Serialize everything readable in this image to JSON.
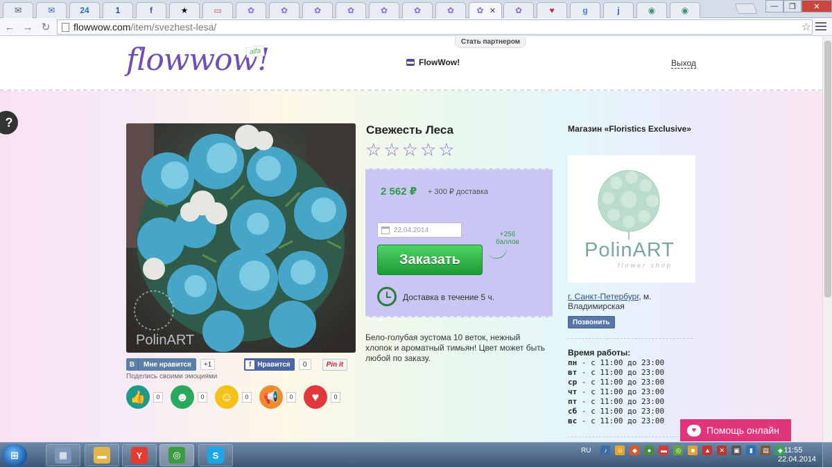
{
  "browser": {
    "tabs": [
      {
        "icon": "mail-icon",
        "label": "",
        "glyph": "✉",
        "color": "#445566"
      },
      {
        "icon": "mail-ru-icon",
        "label": "",
        "glyph": "✉",
        "color": "#2a68b8"
      },
      {
        "icon": "site-24-icon",
        "label": "24",
        "glyph": "24",
        "color": "#2d6db5"
      },
      {
        "icon": "site-1-icon",
        "label": "1",
        "glyph": "1",
        "color": "#1c4f8f"
      },
      {
        "icon": "facebook-icon",
        "label": "",
        "glyph": "f",
        "color": "#3b5998"
      },
      {
        "icon": "black-star-icon",
        "label": "",
        "glyph": "★",
        "color": "#111111"
      },
      {
        "icon": "gallery-icon",
        "label": "",
        "glyph": "▭",
        "color": "#c2473b"
      },
      {
        "icon": "flowwow-icon",
        "label": "",
        "glyph": "✿",
        "color": "#8b6ad1"
      },
      {
        "icon": "flowwow-icon",
        "label": "",
        "glyph": "✿",
        "color": "#8b6ad1"
      },
      {
        "icon": "flowwow-icon",
        "label": "",
        "glyph": "✿",
        "color": "#8b6ad1"
      },
      {
        "icon": "flowwow-icon",
        "label": "",
        "glyph": "✿",
        "color": "#8b6ad1"
      },
      {
        "icon": "flowwow-icon",
        "label": "",
        "glyph": "✿",
        "color": "#8b6ad1"
      },
      {
        "icon": "flowwow-icon",
        "label": "",
        "glyph": "✿",
        "color": "#8b6ad1"
      },
      {
        "icon": "flowwow-icon",
        "label": "",
        "glyph": "✿",
        "color": "#8b6ad1"
      },
      {
        "icon": "flowwow-icon",
        "label": "",
        "glyph": "✿",
        "color": "#8b6ad1",
        "active": true
      },
      {
        "icon": "flowwow-icon",
        "label": "",
        "glyph": "✿",
        "color": "#8b6ad1"
      },
      {
        "icon": "chat-icon",
        "label": "",
        "glyph": "♥",
        "color": "#cc2244"
      },
      {
        "icon": "google-icon",
        "label": "",
        "glyph": "g",
        "color": "#3f7de4"
      },
      {
        "icon": "site-j-icon",
        "label": "",
        "glyph": "j",
        "color": "#2a5fa4"
      },
      {
        "icon": "eye-icon",
        "label": "",
        "glyph": "◉",
        "color": "#3b8f72"
      },
      {
        "icon": "eye-icon",
        "label": "",
        "glyph": "◉",
        "color": "#3b8f72"
      }
    ],
    "url_host": "flowwow.com",
    "url_path": "/item/svezhest-lesa/"
  },
  "header": {
    "logo": "flowwow!",
    "logo_badge": "alfa",
    "partner": "Стать партнером",
    "brand_link": "FlowWow!",
    "logout": "Выход"
  },
  "help_button": "?",
  "product": {
    "title": "Свежесть Леса",
    "rating": 0,
    "rating_max": 5,
    "photo_watermark": "PolinART",
    "price": "2 562 ₽",
    "delivery_fee": "+ 300 ₽ доставка",
    "date_placeholder": "22.04.2014",
    "order_button": "Заказать",
    "bonus_line1": "+256",
    "bonus_line2": "баллов",
    "delivery_time": "Доставка в течение 5 ч.",
    "description": "Бело-голубая эустома 10 веток, нежный хлопок и ароматный тимьян! Цвет может быть любой по заказу."
  },
  "social": {
    "vk_logo": "B",
    "vk_label": "Мне нравится",
    "vk_count": "+1",
    "fb_logo": "f",
    "fb_label": "Нравится",
    "fb_count": "0",
    "pin_label": "Pin it",
    "emotions_label": "Поделись своими эмоциями",
    "emotions": [
      {
        "name": "like",
        "icon": "thumbs-up-icon",
        "glyph": "👍",
        "color": "#1e9a8b",
        "count": "0"
      },
      {
        "name": "laugh",
        "icon": "laugh-icon",
        "glyph": "☻",
        "color": "#2aa85c",
        "count": "0"
      },
      {
        "name": "wow",
        "icon": "surprised-icon",
        "glyph": "☺",
        "color": "#f2c21b",
        "count": "0"
      },
      {
        "name": "shout",
        "icon": "megaphone-icon",
        "glyph": "📢",
        "color": "#f08a2c",
        "count": "0"
      },
      {
        "name": "love",
        "icon": "heart-icon",
        "glyph": "♥",
        "color": "#e0383a",
        "count": "0"
      }
    ]
  },
  "shop": {
    "title": "Магазин «Floristics Exclusive»",
    "logo_name": "PolinART",
    "logo_tagline": "flower shop",
    "city": "г. Санкт-Петербург",
    "address_rest": ", м. Владимирская",
    "call_button": "Позвонить",
    "hours_title": "Время работы:",
    "hours": [
      {
        "day": "пн",
        "time": "- с 11:00 до 23:00"
      },
      {
        "day": "вт",
        "time": "- с 11:00 до 23:00"
      },
      {
        "day": "ср",
        "time": "- с 11:00 до 23:00"
      },
      {
        "day": "чт",
        "time": "- с 11:00 до 23:00"
      },
      {
        "day": "пт",
        "time": "- с 11:00 до 23:00"
      },
      {
        "day": "сб",
        "time": "- с 11:00 до 23:00"
      },
      {
        "day": "вс",
        "time": "- с 11:00 до 23:00"
      }
    ]
  },
  "help_online": "Помощь онлайн",
  "taskbar": {
    "apps": [
      {
        "name": "calculator",
        "icon": "calculator-icon",
        "glyph": "▦",
        "color": "#7a97b8"
      },
      {
        "name": "explorer",
        "icon": "folder-icon",
        "glyph": "▬",
        "color": "#e2b64a"
      },
      {
        "name": "yandex",
        "icon": "yandex-browser-icon",
        "glyph": "Y",
        "color": "#e63b2e"
      },
      {
        "name": "chrome",
        "icon": "chrome-icon",
        "glyph": "◎",
        "color": "#3f9b42",
        "active": true
      },
      {
        "name": "skype",
        "icon": "skype-icon",
        "glyph": "S",
        "color": "#1ba6e8"
      }
    ],
    "lang": "RU",
    "time": "11:55",
    "date": "22.04.2014"
  }
}
